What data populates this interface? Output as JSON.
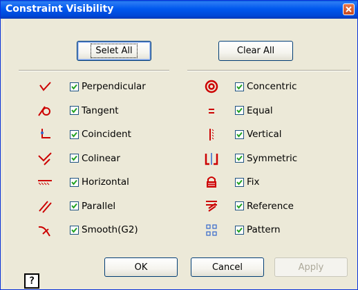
{
  "window": {
    "title": "Constraint Visibility"
  },
  "buttons": {
    "select_all": "Selet All",
    "clear_all": "Clear All",
    "ok": "OK",
    "cancel": "Cancel",
    "apply": "Apply",
    "help": "?"
  },
  "left_items": [
    {
      "label": "Perpendicular",
      "checked": true,
      "icon": "perpendicular-icon"
    },
    {
      "label": "Tangent",
      "checked": true,
      "icon": "tangent-icon"
    },
    {
      "label": "Coincident",
      "checked": true,
      "icon": "coincident-icon"
    },
    {
      "label": "Colinear",
      "checked": true,
      "icon": "colinear-icon"
    },
    {
      "label": "Horizontal",
      "checked": true,
      "icon": "horizontal-icon"
    },
    {
      "label": "Parallel",
      "checked": true,
      "icon": "parallel-icon"
    },
    {
      "label": "Smooth(G2)",
      "checked": true,
      "icon": "smooth-g2-icon"
    }
  ],
  "right_items": [
    {
      "label": "Concentric",
      "checked": true,
      "icon": "concentric-icon"
    },
    {
      "label": "Equal",
      "checked": true,
      "icon": "equal-icon"
    },
    {
      "label": "Vertical",
      "checked": true,
      "icon": "vertical-icon"
    },
    {
      "label": "Symmetric",
      "checked": true,
      "icon": "symmetric-icon"
    },
    {
      "label": "Fix",
      "checked": true,
      "icon": "fix-icon"
    },
    {
      "label": "Reference",
      "checked": true,
      "icon": "reference-icon"
    },
    {
      "label": "Pattern",
      "checked": true,
      "icon": "pattern-icon"
    }
  ],
  "colors": {
    "icon_red": "#cc0000",
    "title_blue": "#0058ee",
    "check_green": "#21a121"
  }
}
